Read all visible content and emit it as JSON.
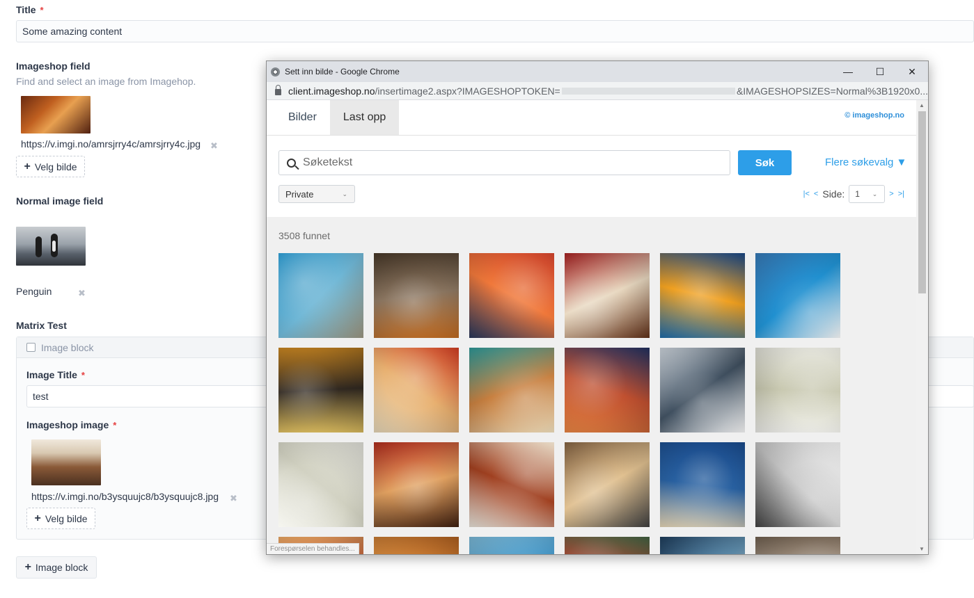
{
  "form": {
    "title_label": "Title",
    "title_required": "*",
    "title_value": "Some amazing content",
    "imageshop_field": {
      "label": "Imageshop field",
      "hint": "Find and select an image from Imagehop.",
      "url": "https://v.imgi.no/amrsjrry4c/amrsjrry4c.jpg",
      "remove": "✖",
      "button": "Velg bilde"
    },
    "normal_image_field": {
      "label": "Normal image field",
      "caption": "Penguin",
      "remove": "✖"
    },
    "matrix": {
      "label": "Matrix Test",
      "block_header": "Image block",
      "image_title_label": "Image Title",
      "image_title_required": "*",
      "image_title_value": "test",
      "imageshop_image_label": "Imageshop image",
      "imageshop_image_required": "*",
      "url": "https://v.imgi.no/b3ysquujc8/b3ysquujc8.jpg",
      "remove": "✖",
      "button": "Velg bilde",
      "add_block_button": "Image block"
    },
    "plus_icon": "+"
  },
  "popup": {
    "window_title": "Sett inn bilde - Google Chrome",
    "controls": {
      "minimize": "—",
      "maximize": "☐",
      "close": "✕"
    },
    "url_host": "client.imageshop.no",
    "url_path_start": "/insertimage2.aspx?IMAGESHOPTOKEN=",
    "url_path_end": "&IMAGESHOPSIZES=Normal%3B1920x0...",
    "tabs": [
      {
        "label": "Bilder"
      },
      {
        "label": "Last opp"
      }
    ],
    "brand": "© imageshop.no",
    "search": {
      "placeholder": "Søketekst",
      "button": "Søk",
      "more_options": "Flere søkevalg ▼"
    },
    "filter": {
      "selected": "Private",
      "caret": "⌄"
    },
    "pager": {
      "first": "|<",
      "prev": "<",
      "label": "Side:",
      "page": "1",
      "caret": "⌄",
      "next": ">",
      "last": ">|"
    },
    "results_count": "3508 funnet",
    "status_text": "Forespørselen behandles...",
    "scroll": {
      "up": "▲",
      "down": "▼"
    },
    "images": [
      {
        "name": "pool-deck",
        "colors": [
          "#2b8fc0",
          "#6fb7d6",
          "#a7a18a"
        ]
      },
      {
        "name": "forest-worker",
        "colors": [
          "#4a3a2a",
          "#8a7560",
          "#c06a20"
        ]
      },
      {
        "name": "sunset-sea",
        "colors": [
          "#c8402a",
          "#f0783a",
          "#2a3a60"
        ]
      },
      {
        "name": "dining-room",
        "colors": [
          "#a02020",
          "#e8d8c0",
          "#603018"
        ]
      },
      {
        "name": "lounge-bar",
        "colors": [
          "#1a4a8a",
          "#f0a020",
          "#2070b0"
        ]
      },
      {
        "name": "ship-pool",
        "colors": [
          "#3a80c0",
          "#2090d0",
          "#e0e0e0"
        ]
      },
      {
        "name": "atrium",
        "colors": [
          "#c08020",
          "#302820",
          "#e0c060"
        ]
      },
      {
        "name": "cabin-red",
        "colors": [
          "#c83a20",
          "#e8b070",
          "#f0e0c0"
        ]
      },
      {
        "name": "teal-lounge",
        "colors": [
          "#30a0a0",
          "#c88040",
          "#e0d0b0"
        ]
      },
      {
        "name": "night-lounge",
        "colors": [
          "#203060",
          "#c05030",
          "#e08040"
        ]
      },
      {
        "name": "yoga-class",
        "colors": [
          "#d8e0e8",
          "#405060",
          "#f0f0f0"
        ]
      },
      {
        "name": "world-map",
        "colors": [
          "#e8e8e0",
          "#c8c8b0",
          "#f4f4f0"
        ]
      },
      {
        "name": "route-map",
        "colors": [
          "#ecece4",
          "#d0d0c0",
          "#f6f6f0"
        ]
      },
      {
        "name": "suite-red",
        "colors": [
          "#b83020",
          "#e0a060",
          "#402010"
        ]
      },
      {
        "name": "bedroom",
        "colors": [
          "#e8dcc8",
          "#a04020",
          "#f4eee4"
        ]
      },
      {
        "name": "cafe",
        "colors": [
          "#806040",
          "#e0c090",
          "#404040"
        ]
      },
      {
        "name": "eagle",
        "colors": [
          "#1a4a8a",
          "#2860a0",
          "#f0e0c0"
        ]
      },
      {
        "name": "europe-map",
        "colors": [
          "#f0f0f0",
          "#c8c8c8",
          "#404040"
        ]
      },
      {
        "name": "row4-1",
        "colors": [
          "#e0a060",
          "#c05030",
          "#f0d0a0"
        ]
      },
      {
        "name": "row4-2",
        "colors": [
          "#b06020",
          "#e09040",
          "#402010"
        ]
      },
      {
        "name": "row4-3",
        "colors": [
          "#80c0e0",
          "#4090c0",
          "#e0f0f8"
        ]
      },
      {
        "name": "row4-4",
        "colors": [
          "#406040",
          "#c04030",
          "#e0e0e0"
        ]
      },
      {
        "name": "row4-5",
        "colors": [
          "#204060",
          "#6090b0",
          "#e0e0e0"
        ]
      },
      {
        "name": "row4-6",
        "colors": [
          "#706050",
          "#c0b0a0",
          "#f0f0f0"
        ]
      }
    ]
  }
}
